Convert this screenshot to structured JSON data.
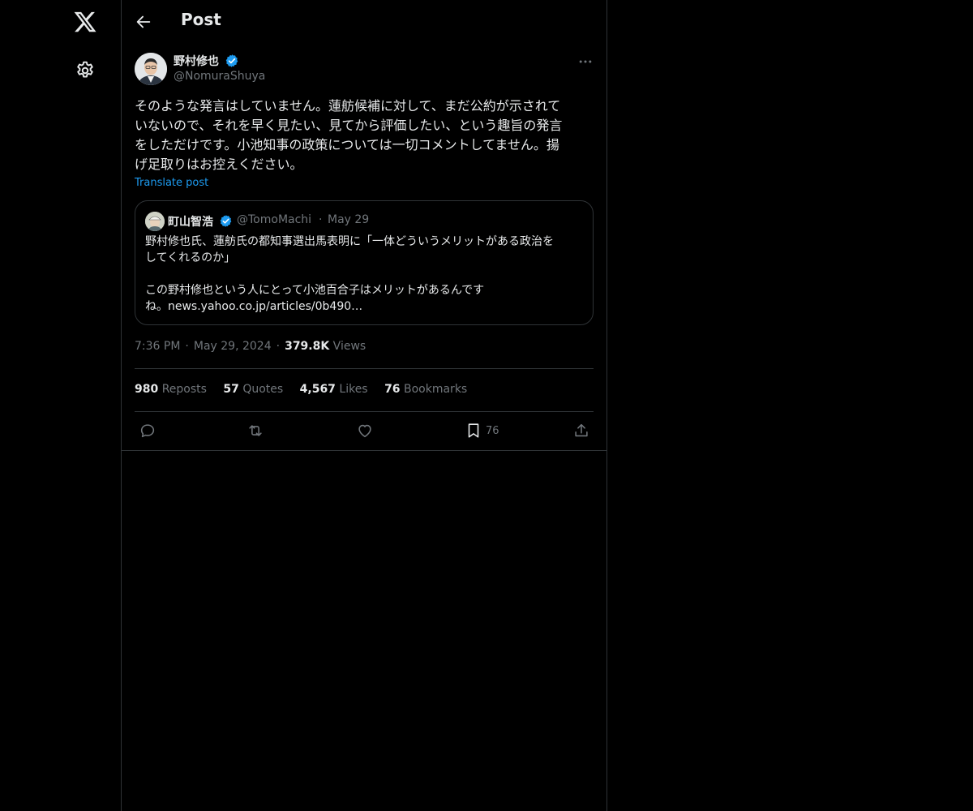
{
  "header": {
    "title": "Post"
  },
  "post": {
    "author_name": "野村修也",
    "author_handle": "@NomuraShuya",
    "text": "そのような発言はしていません。蓮舫候補に対して、まだ公約が示されて\nいないので、それを早く見たい、見てから評価したい、という趣旨の発言\nをしただけです。小池知事の政策については一切コメントしてません。揚\nげ足取りはお控えください。",
    "translate_label": "Translate post",
    "time": "7:36 PM",
    "date": "May 29, 2024",
    "views_count": "379.8K",
    "views_label": "Views"
  },
  "quote": {
    "author_name": "町山智浩",
    "author_handle": "@TomoMachi",
    "date": "May 29",
    "text": "野村修也氏、蓮舫氏の都知事選出馬表明に「一体どういうメリットがある政治を\nしてくれるのか」\n\nこの野村修也という人にとって小池百合子はメリットがあるんです\nね。news.yahoo.co.jp/articles/0b490…"
  },
  "stats": {
    "reposts_count": "980",
    "reposts_label": "Reposts",
    "quotes_count": "57",
    "quotes_label": "Quotes",
    "likes_count": "4,567",
    "likes_label": "Likes",
    "bookmarks_count": "76",
    "bookmarks_label": "Bookmarks"
  },
  "actions": {
    "bookmark_count": "76"
  },
  "icons": [
    "x-logo-icon",
    "gear-icon",
    "back-arrow-icon",
    "verified-badge-icon",
    "more-icon",
    "reply-icon",
    "repost-icon",
    "like-icon",
    "bookmark-icon",
    "share-icon"
  ],
  "colors": {
    "background": "#000000",
    "text": "#e7e9ea",
    "muted": "#71767b",
    "accent": "#1d9bf0",
    "border": "#2f3336"
  }
}
